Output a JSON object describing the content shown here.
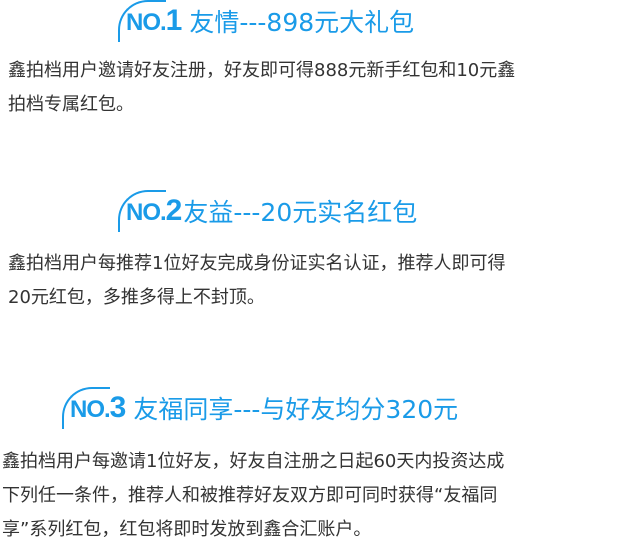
{
  "sections": [
    {
      "badge_prefix": "NO.",
      "badge_num": "1",
      "title": "友情---898元大礼包",
      "lines": [
        "鑫拍档用户邀请好友注册，好友即可得888元新手红包和10元鑫",
        "拍档专属红包。"
      ]
    },
    {
      "badge_prefix": "NO.",
      "badge_num": "2",
      "title": "友益---20元实名红包",
      "lines": [
        "鑫拍档用户每推荐1位好友完成身份证实名认证，推荐人即可得",
        "20元红包，多推多得上不封顶。"
      ]
    },
    {
      "badge_prefix": "NO.",
      "badge_num": "3",
      "title": "友福同享---与好友均分320元",
      "lines": [
        "鑫拍档用户每邀请1位好友，好友自注册之日起60天内投资达成",
        "下列任一条件，推荐人和被推荐好友双方即可同时获得“友福同",
        "享”系列红包，红包将即时发放到鑫合汇账户。"
      ]
    }
  ],
  "colors": {
    "accent": "#1a9be8",
    "text": "#333333"
  }
}
